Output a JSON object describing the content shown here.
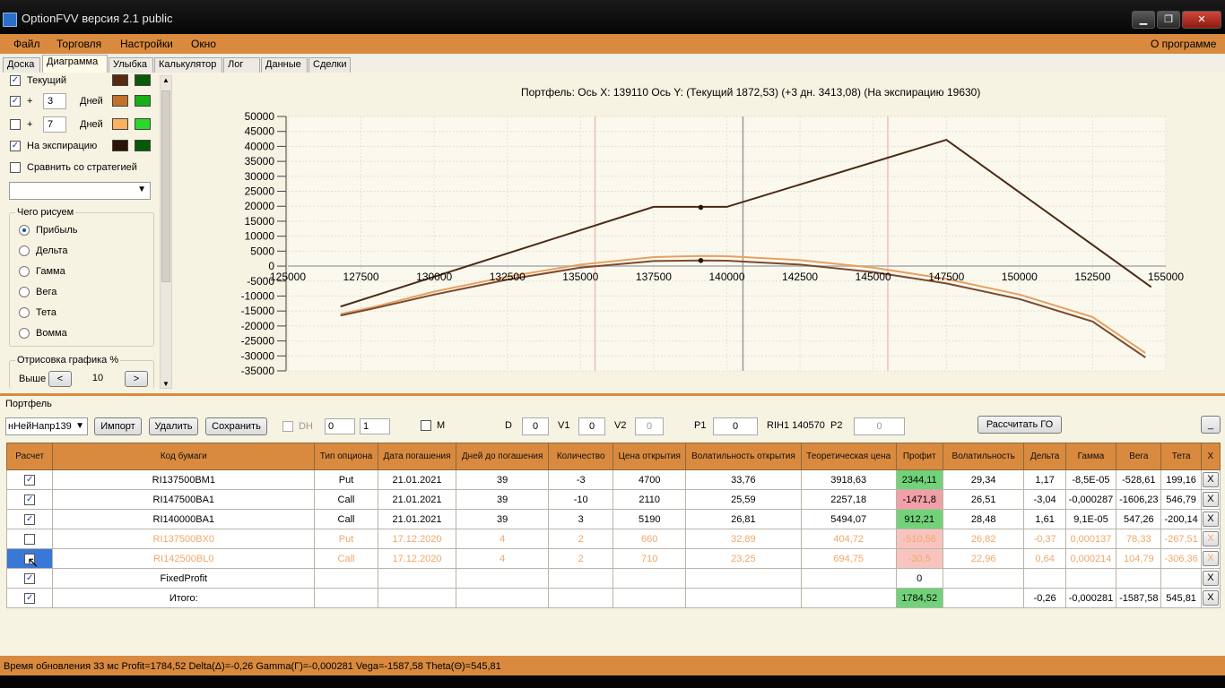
{
  "window": {
    "title": "OptionFVV версия 2.1 public",
    "minimize": "▁",
    "maximize": "❐",
    "close": "✕"
  },
  "menu": {
    "items": [
      "Файл",
      "Торговля",
      "Настройки",
      "Окно"
    ],
    "about": "О программе"
  },
  "tabs": [
    "Доска",
    "Диаграмма",
    "Улыбка",
    "Калькулятор",
    "Лог",
    "Данные",
    "Сделки"
  ],
  "active_tab": "Диаграмма",
  "left_panel": {
    "current": {
      "label": "Текущий",
      "checked": true,
      "colors": [
        "#5a2a10",
        "#0a5a0a"
      ]
    },
    "plus3": {
      "plus": "+",
      "days": "3",
      "unit": "Дней",
      "checked": true,
      "colors": [
        "#c2702a",
        "#18b018"
      ]
    },
    "plus7": {
      "plus": "+",
      "days": "7",
      "unit": "Дней",
      "checked": false,
      "colors": [
        "#ffb060",
        "#2ad62a"
      ]
    },
    "expiry": {
      "label": "На экспирацию",
      "checked": true,
      "colors": [
        "#2a1408",
        "#065a06"
      ]
    },
    "compare": {
      "label": "Сравнить со стратегией",
      "checked": false
    },
    "strategy_select": "",
    "draw_group": {
      "title": "Чего рисуем",
      "options": [
        "Прибыль",
        "Дельта",
        "Гамма",
        "Вега",
        "Тета",
        "Вомма"
      ],
      "selected": "Прибыль"
    },
    "render_group": {
      "title": "Отрисовка графика %",
      "label": "Выше",
      "value": "10",
      "dec": "<",
      "inc": ">"
    }
  },
  "chart_data": {
    "type": "line",
    "title": "Портфель: Ось X: 139110 Ось Y:  (Текущий 1872,53)  (+3 дн. 3413,08)  (На экспирацию 19630)",
    "xlim": [
      125000,
      155000
    ],
    "ylim": [
      -35000,
      50000
    ],
    "x_ticks": [
      "125000",
      "127500",
      "130000",
      "132500",
      "135000",
      "137500",
      "140000",
      "142500",
      "145000",
      "147500",
      "150000",
      "152500",
      "155000"
    ],
    "y_ticks": [
      "50000",
      "45000",
      "40000",
      "35000",
      "30000",
      "25000",
      "20000",
      "15000",
      "10000",
      "5000",
      "0",
      "-5000",
      "-10000",
      "-15000",
      "-20000",
      "-25000",
      "-30000",
      "-35000"
    ],
    "vlines_red": [
      135500,
      145500
    ],
    "vline_gray": 140550,
    "series": [
      {
        "name": "На экспирацию",
        "color": "#4a2a14",
        "points": [
          [
            126800,
            -13500
          ],
          [
            137500,
            19800
          ],
          [
            140000,
            19800
          ],
          [
            147500,
            42200
          ],
          [
            154500,
            -7000
          ]
        ],
        "marker": [
          139110,
          19630
        ]
      },
      {
        "name": "Текущий",
        "color": "#7a4a30",
        "points": [
          [
            126800,
            -16500
          ],
          [
            128000,
            -14000
          ],
          [
            130000,
            -9500
          ],
          [
            132500,
            -4500
          ],
          [
            135000,
            -500
          ],
          [
            137500,
            1700
          ],
          [
            139110,
            1900
          ],
          [
            140000,
            1800
          ],
          [
            142500,
            500
          ],
          [
            145000,
            -2000
          ],
          [
            147500,
            -5800
          ],
          [
            150000,
            -11000
          ],
          [
            152500,
            -18500
          ],
          [
            154300,
            -30500
          ]
        ],
        "marker": [
          139110,
          1872.53
        ]
      },
      {
        "name": "+3 дн.",
        "color": "#e8a060",
        "points": [
          [
            126800,
            -16000
          ],
          [
            128000,
            -13500
          ],
          [
            130000,
            -8500
          ],
          [
            132500,
            -3500
          ],
          [
            135000,
            500
          ],
          [
            137500,
            3000
          ],
          [
            139110,
            3400
          ],
          [
            140000,
            3300
          ],
          [
            142500,
            2000
          ],
          [
            145000,
            -500
          ],
          [
            147500,
            -4300
          ],
          [
            150000,
            -9500
          ],
          [
            152500,
            -17000
          ],
          [
            154300,
            -29000
          ]
        ]
      }
    ]
  },
  "portfolio": {
    "label": "Портфель",
    "select_value": "нНейНапр139",
    "buttons": {
      "import": "Импорт",
      "delete": "Удалить",
      "save": "Сохранить",
      "calc": "Рассчитать ГО",
      "minus": "_"
    },
    "dh": "DH",
    "spin1": "0",
    "spin2": "1",
    "m": "M",
    "d_label": "D",
    "d_value": "0",
    "v1_label": "V1",
    "v1_value": "0",
    "v2_label": "V2",
    "v2_value": "0",
    "p1_label": "P1",
    "p1_value": "0",
    "rih": "RIH1 140570",
    "p2_label": "P2",
    "p2_value": "0"
  },
  "table": {
    "headers": [
      "Расчет",
      "Код бумаги",
      "Тип опциона",
      "Дата погашения",
      "Дней до погашения",
      "Количество",
      "Цена открытия",
      "Волатильность открытия",
      "Теоретическая цена",
      "Профит",
      "Волатильность",
      "Дельта",
      "Гамма",
      "Вега",
      "Тета",
      "X"
    ],
    "rows": [
      {
        "checked": true,
        "dim": false,
        "code": "RI137500BM1",
        "type": "Put",
        "date": "21.01.2021",
        "days": "39",
        "qty": "-3",
        "open_price": "4700",
        "open_vol": "33,76",
        "theo": "3918,63",
        "profit": "2344,11",
        "profit_class": "green",
        "vol": "29,34",
        "delta": "1,17",
        "gamma": "-8,5E-05",
        "vega": "-528,61",
        "theta": "199,16"
      },
      {
        "checked": true,
        "dim": false,
        "code": "RI147500BA1",
        "type": "Call",
        "date": "21.01.2021",
        "days": "39",
        "qty": "-10",
        "open_price": "2110",
        "open_vol": "25,59",
        "theo": "2257,18",
        "profit": "-1471,8",
        "profit_class": "red",
        "vol": "26,51",
        "delta": "-3,04",
        "gamma": "-0,000287",
        "vega": "-1606,23",
        "theta": "546,79"
      },
      {
        "checked": true,
        "dim": false,
        "code": "RI140000BA1",
        "type": "Call",
        "date": "21.01.2021",
        "days": "39",
        "qty": "3",
        "open_price": "5190",
        "open_vol": "26,81",
        "theo": "5494,07",
        "profit": "912,21",
        "profit_class": "green",
        "vol": "28,48",
        "delta": "1,61",
        "gamma": "9,1E-05",
        "vega": "547,26",
        "theta": "-200,14"
      },
      {
        "checked": false,
        "dim": true,
        "code": "RI137500BX0",
        "type": "Put",
        "date": "17.12.2020",
        "days": "4",
        "qty": "2",
        "open_price": "660",
        "open_vol": "32,89",
        "theo": "404,72",
        "profit": "-510,56",
        "profit_class": "pinkdim",
        "vol": "26,82",
        "delta": "-0,37",
        "gamma": "0,000137",
        "vega": "78,33",
        "theta": "-267,51"
      },
      {
        "checked": false,
        "dim": true,
        "code": "RI142500BL0",
        "type": "Call",
        "date": "17.12.2020",
        "days": "4",
        "qty": "2",
        "open_price": "710",
        "open_vol": "23,25",
        "theo": "694,75",
        "profit": "-30,5",
        "profit_class": "pinkdim",
        "vol": "22,96",
        "delta": "0,64",
        "gamma": "0,000214",
        "vega": "104,79",
        "theta": "-306,36"
      },
      {
        "checked": true,
        "dim": false,
        "code": "FixedProfit",
        "type": "",
        "date": "",
        "days": "",
        "qty": "",
        "open_price": "",
        "open_vol": "",
        "theo": "",
        "profit": "0",
        "profit_class": "",
        "vol": "",
        "delta": "",
        "gamma": "",
        "vega": "",
        "theta": ""
      },
      {
        "checked": true,
        "dim": false,
        "code": "Итого:",
        "type": "",
        "date": "",
        "days": "",
        "qty": "",
        "open_price": "",
        "open_vol": "",
        "theo": "",
        "profit": "1784,52",
        "profit_class": "green",
        "vol": "",
        "delta": "-0,26",
        "gamma": "-0,000281",
        "vega": "-1587,58",
        "theta": "545,81"
      }
    ],
    "delete_label": "X"
  },
  "status": "Время обновления 33 мс  Profit=1784,52 Delta(Δ)=-0,26 Gamma(Γ)=-0,000281 Vega=-1587,58 Theta(Θ)=545,81"
}
